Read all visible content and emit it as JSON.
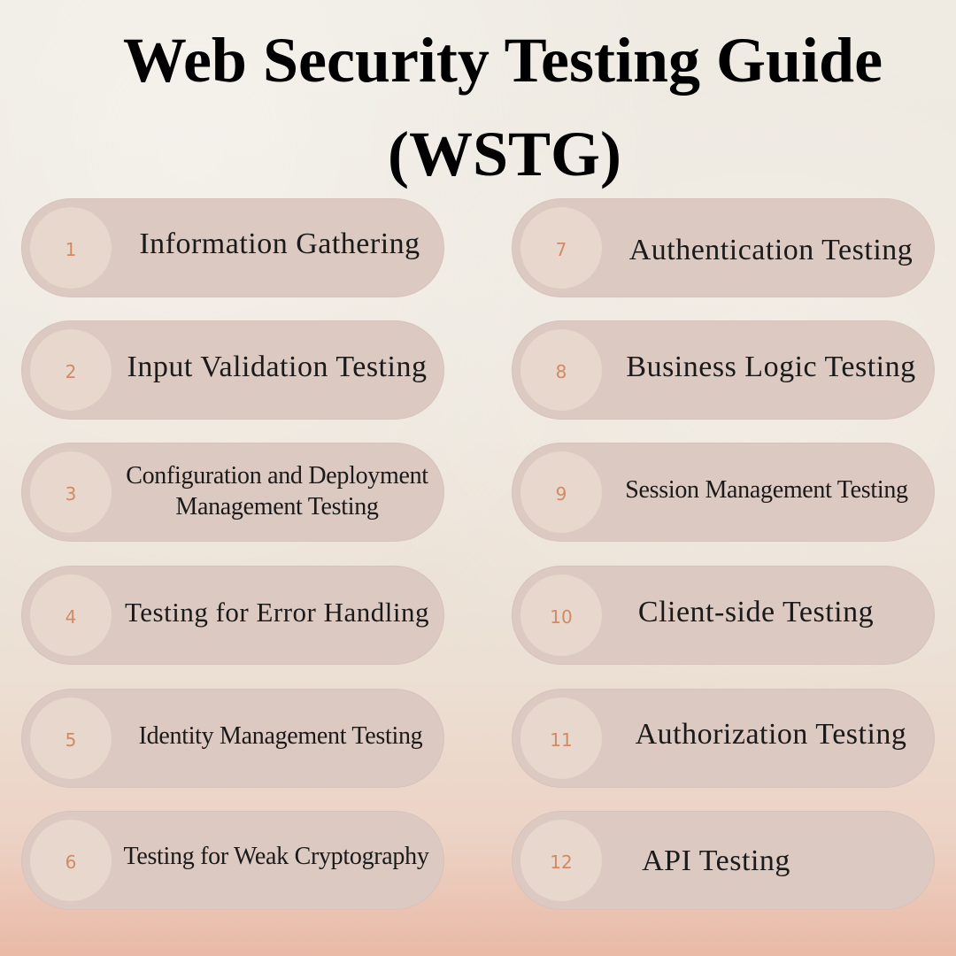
{
  "title": {
    "line1": "Web Security Testing Guide",
    "line2": "(WSTG)"
  },
  "items": [
    {
      "num": "1",
      "label": "Information Gathering"
    },
    {
      "num": "2",
      "label": "Input Validation Testing"
    },
    {
      "num": "3",
      "label": "Configuration and Deployment\nManagement Testing"
    },
    {
      "num": "4",
      "label": "Testing for Error Handling"
    },
    {
      "num": "5",
      "label": "Identity Management Testing"
    },
    {
      "num": "6",
      "label": "Testing for Weak Cryptography"
    },
    {
      "num": "7",
      "label": "Authentication Testing"
    },
    {
      "num": "8",
      "label": "Business Logic Testing"
    },
    {
      "num": "9",
      "label": "Session Management Testing"
    },
    {
      "num": "10",
      "label": "Client-side Testing"
    },
    {
      "num": "11",
      "label": "Authorization Testing"
    },
    {
      "num": "12",
      "label": "API Testing"
    }
  ],
  "colors": {
    "pill": "#dcc9c2",
    "badge": "#e8d7cd",
    "number": "#d18a63",
    "title": "#000000"
  }
}
